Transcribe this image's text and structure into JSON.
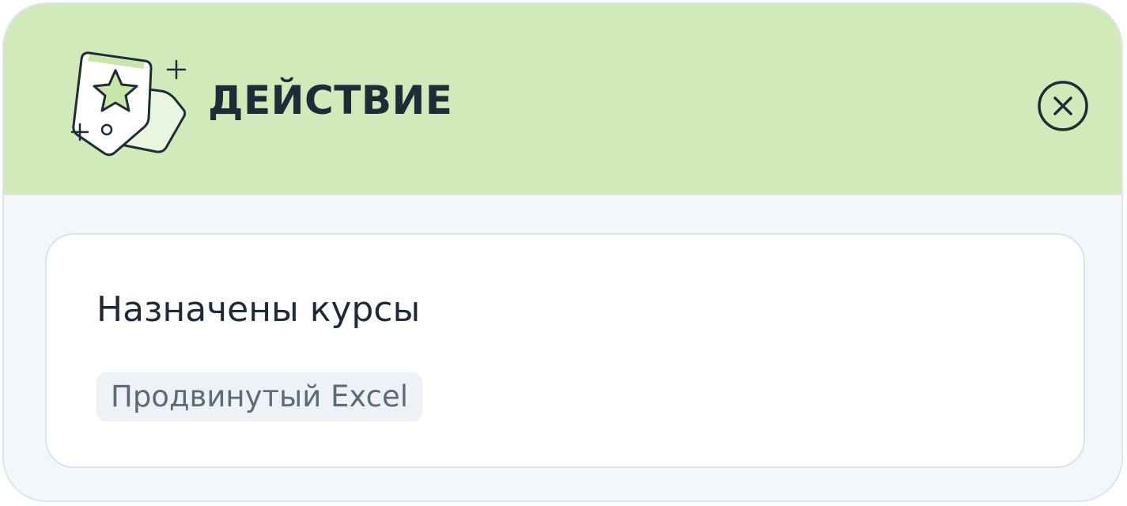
{
  "header": {
    "title": "ДЕЙСТВИЕ",
    "icon": "price-tag-star-icon",
    "close_icon": "close-circle-icon"
  },
  "content": {
    "title": "Назначены курсы",
    "tags": [
      "Продвинутый Excel"
    ]
  },
  "colors": {
    "header_bg": "#d1eab9",
    "card_bg": "#f4f7fa",
    "panel_bg": "#ffffff",
    "text_dark": "#1f2c38",
    "tag_bg": "#eef2f6",
    "tag_text": "#5c6b7c"
  }
}
